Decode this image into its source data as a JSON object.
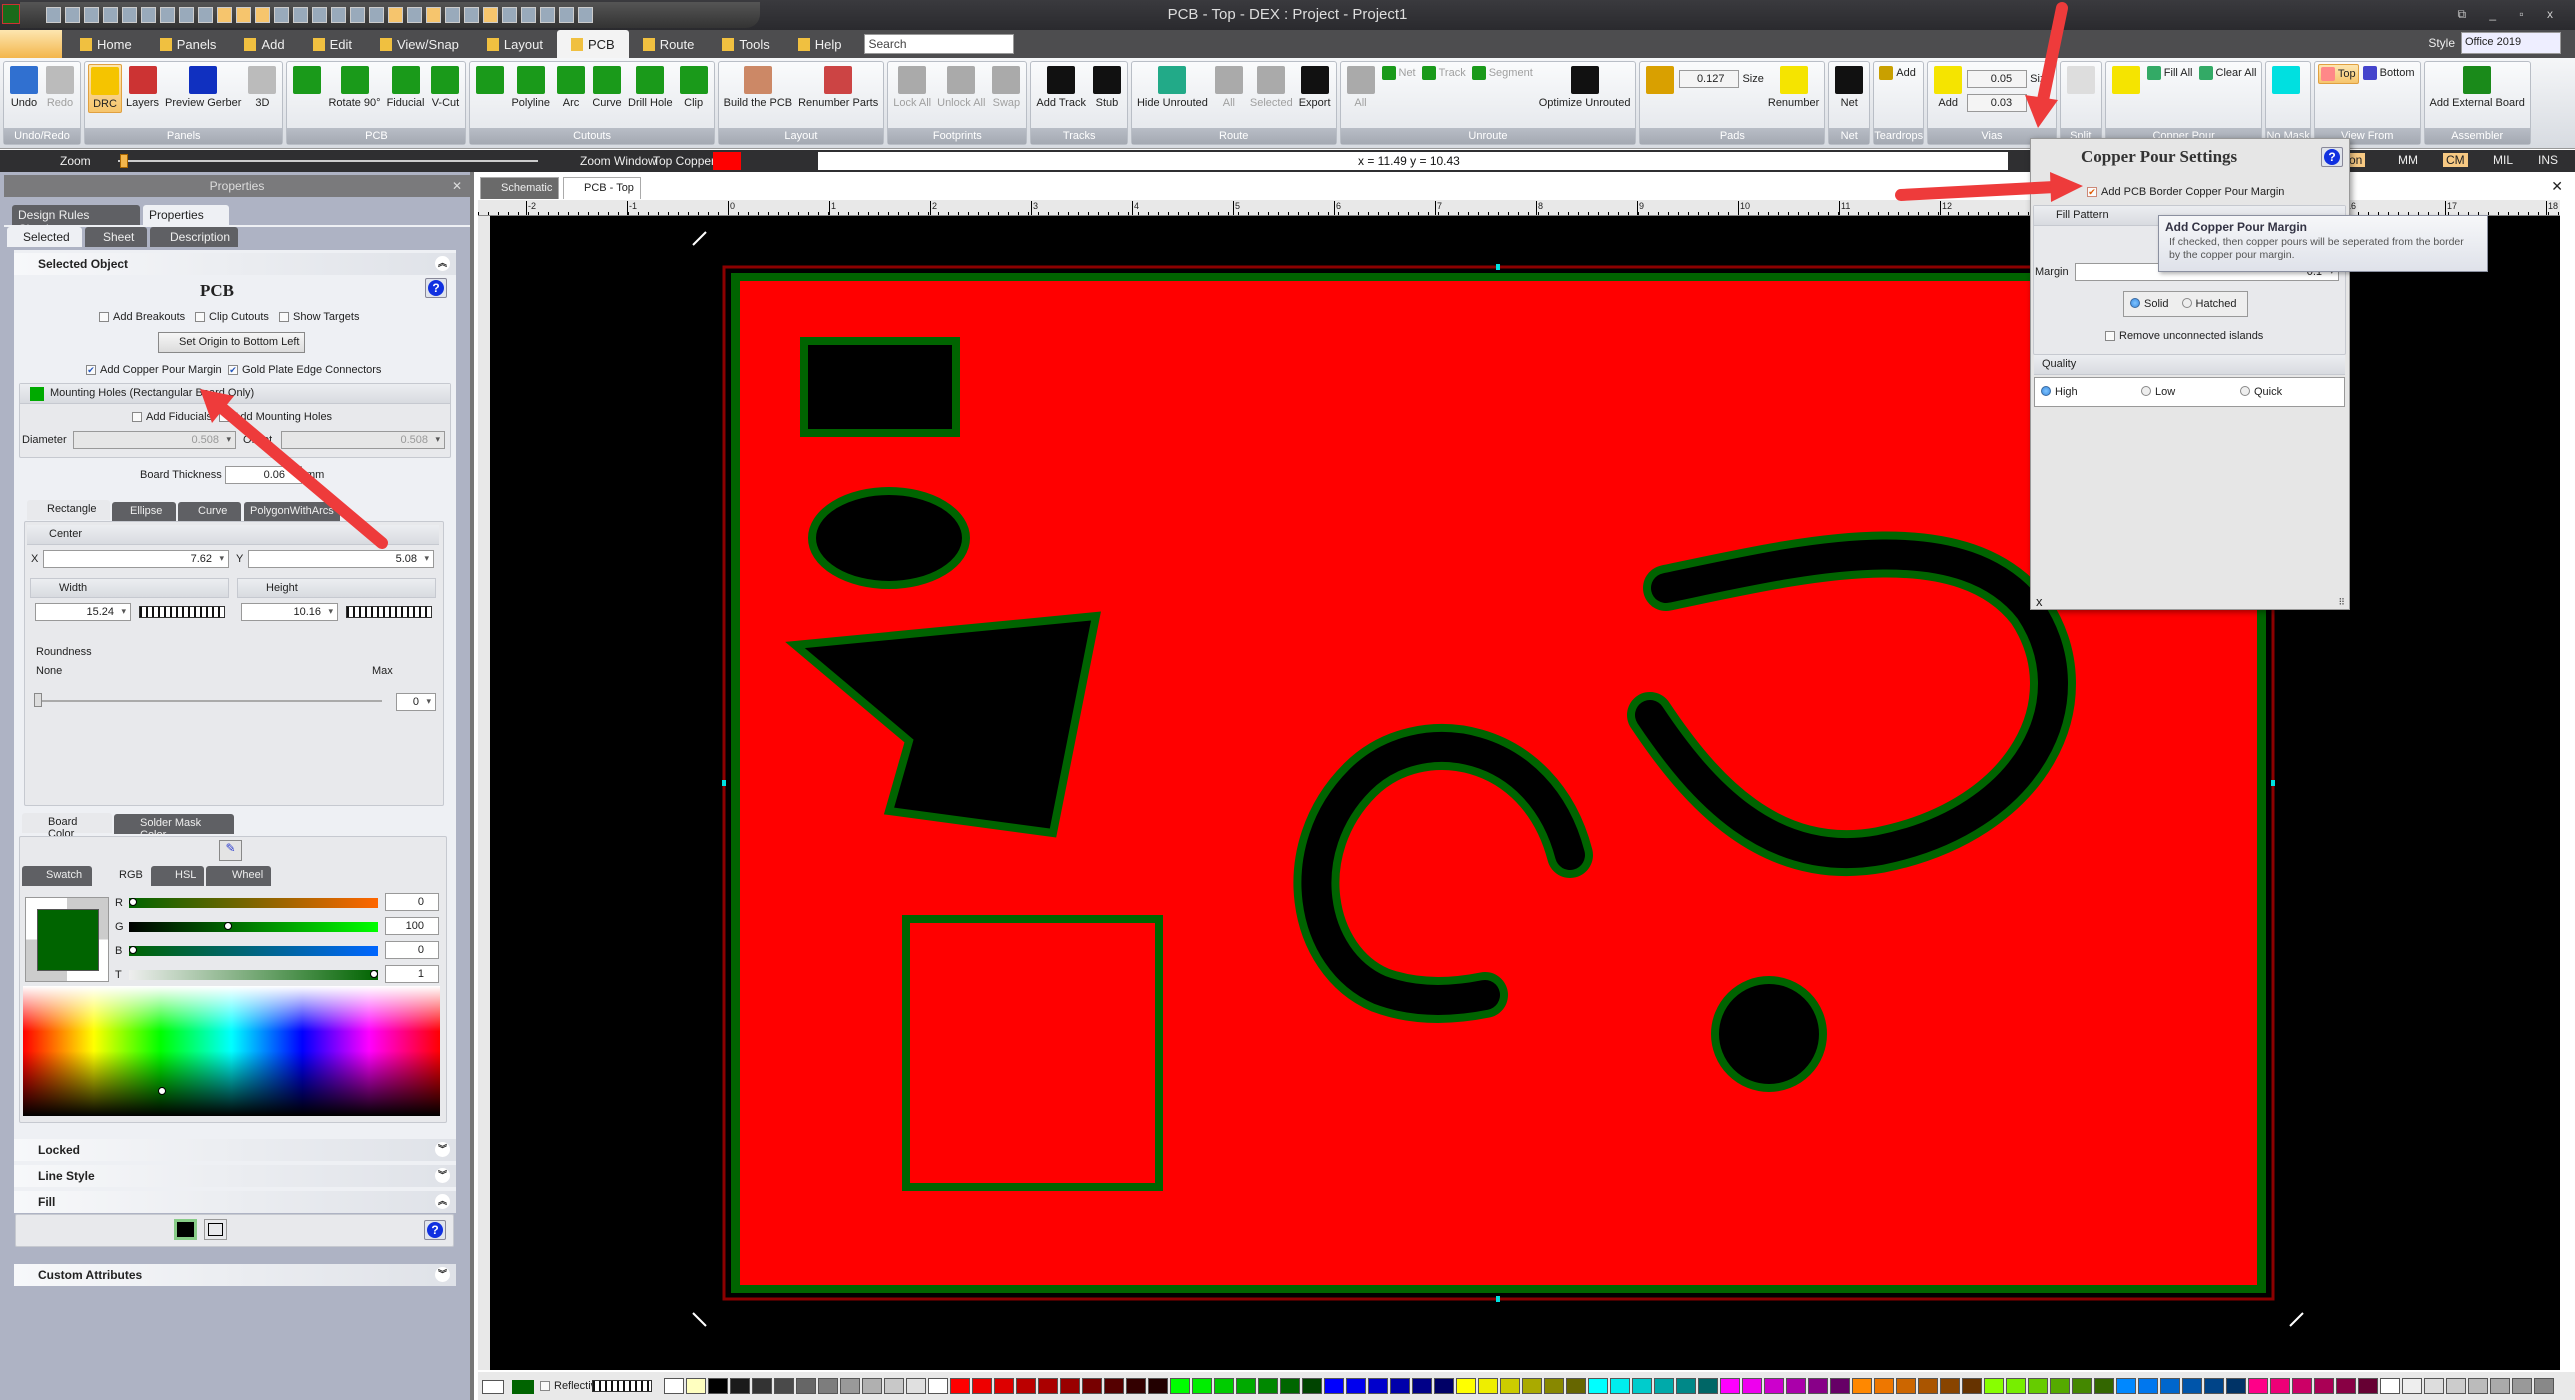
{
  "window": {
    "title": "PCB - Top - DEX : Project - Project1",
    "controls": "⧉ _ ▫ x"
  },
  "menu": {
    "tabs": [
      {
        "label": "Home"
      },
      {
        "label": "Panels"
      },
      {
        "label": "Add"
      },
      {
        "label": "Edit"
      },
      {
        "label": "View/Snap"
      },
      {
        "label": "Layout"
      },
      {
        "label": "PCB",
        "active": true
      },
      {
        "label": "Route"
      },
      {
        "label": "Tools"
      },
      {
        "label": "Help"
      }
    ],
    "search_placeholder": "Search",
    "style_label": "Style",
    "style_value": "Office 2019"
  },
  "ribbon": {
    "groups": [
      {
        "label": "Undo/Redo",
        "buttons": [
          {
            "label": "Undo",
            "icon": "undo-icon"
          },
          {
            "label": "Redo",
            "icon": "redo-icon",
            "disabled": true
          }
        ]
      },
      {
        "label": "Panels",
        "buttons": [
          {
            "label": "DRC",
            "icon": "warning-icon",
            "active": true
          },
          {
            "label": "Layers",
            "icon": "layers-icon"
          },
          {
            "label": "Preview Gerber",
            "icon": "gerber-icon"
          },
          {
            "label": "3D",
            "icon": "cube-icon"
          }
        ]
      },
      {
        "label": "PCB",
        "buttons": [
          {
            "label": "",
            "icon": "board-shapes-icon"
          },
          {
            "label": "Rotate 90°",
            "icon": "rotate-icon"
          },
          {
            "label": "Fiducial",
            "icon": "fiducial-icon"
          },
          {
            "label": "V-Cut",
            "icon": "vcut-icon"
          }
        ]
      },
      {
        "label": "Cutouts",
        "buttons": [
          {
            "label": "",
            "icon": "cutout-shapes-icon"
          },
          {
            "label": "Polyline",
            "icon": "polyline-icon"
          },
          {
            "label": "Arc",
            "icon": "arc-icon"
          },
          {
            "label": "Curve",
            "icon": "curve-icon"
          },
          {
            "label": "Drill Hole",
            "icon": "drill-icon"
          },
          {
            "label": "Clip",
            "icon": "clip-icon"
          }
        ]
      },
      {
        "label": "Layout",
        "buttons": [
          {
            "label": "Build the PCB",
            "icon": "build-icon"
          },
          {
            "label": "Renumber Parts",
            "icon": "renumber-parts-icon"
          }
        ]
      },
      {
        "label": "Footprints",
        "buttons": [
          {
            "label": "Lock All",
            "icon": "lock-icon",
            "disabled": true
          },
          {
            "label": "Unlock All",
            "icon": "unlock-icon",
            "disabled": true
          },
          {
            "label": "Swap",
            "icon": "swap-icon",
            "disabled": true
          }
        ]
      },
      {
        "label": "Tracks",
        "buttons": [
          {
            "label": "Add Track",
            "icon": "add-track-icon"
          },
          {
            "label": "Stub",
            "icon": "stub-icon"
          }
        ]
      },
      {
        "label": "Route",
        "buttons": [
          {
            "label": "Hide Unrouted",
            "icon": "hide-icon"
          },
          {
            "label": "All",
            "icon": "route-all-icon",
            "disabled": true
          },
          {
            "label": "Selected",
            "icon": "route-selected-icon",
            "disabled": true
          },
          {
            "label": "Export",
            "icon": "export-icon"
          }
        ]
      },
      {
        "label": "Unroute",
        "buttons": [
          {
            "label": "All",
            "icon": "unroute-all-icon",
            "disabled": true
          },
          {
            "label": "Net",
            "icon": "unroute-net-icon",
            "disabled": true,
            "small": true
          },
          {
            "label": "Track",
            "icon": "unroute-track-icon",
            "disabled": true,
            "small": true
          },
          {
            "label": "Segment",
            "icon": "unroute-segment-icon",
            "disabled": true,
            "small": true
          },
          {
            "label": "Optimize Unrouted",
            "icon": "optimize-icon"
          }
        ]
      },
      {
        "label": "Pads",
        "buttons": [
          {
            "label": "",
            "icon": "pad-shapes-icon"
          }
        ],
        "inputs": [
          {
            "label": "Size",
            "value": "0.127"
          }
        ],
        "buttons_after": [
          {
            "label": "Renumber",
            "icon": "renumber-icon"
          }
        ]
      },
      {
        "label": "Net",
        "buttons": [
          {
            "label": "Net",
            "icon": "net-icon"
          }
        ]
      },
      {
        "label": "Teardrops",
        "buttons": [
          {
            "label": "Add",
            "icon": "teardrop-icon",
            "small": true
          }
        ]
      },
      {
        "label": "Vias",
        "buttons": [
          {
            "label": "Add",
            "icon": "via-icon"
          }
        ],
        "inputs": [
          {
            "label": "Size",
            "value": "0.05"
          },
          {
            "label": "Hole",
            "value": "0.03"
          }
        ]
      },
      {
        "label": "Split",
        "buttons": [
          {
            "label": "",
            "icon": "split-icon"
          }
        ]
      },
      {
        "label": "Copper Pour",
        "buttons": [
          {
            "label": "",
            "icon": "pour-shapes-icon"
          },
          {
            "label": "Fill All",
            "icon": "fill-all-icon",
            "small": true
          },
          {
            "label": "Clear All",
            "icon": "clear-all-icon",
            "small": true
          }
        ]
      },
      {
        "label": "No Mask",
        "buttons": [
          {
            "label": "",
            "icon": "no-mask-icon"
          }
        ]
      },
      {
        "label": "View From",
        "buttons": [
          {
            "label": "Top",
            "icon": "view-top-icon",
            "small": true,
            "active": true
          },
          {
            "label": "Bottom",
            "icon": "view-bottom-icon",
            "small": true
          }
        ]
      },
      {
        "label": "Assembler",
        "buttons": [
          {
            "label": "Add External Board",
            "icon": "external-board-icon"
          }
        ]
      }
    ]
  },
  "zoombar": {
    "zoom_label": "Zoom",
    "zoom_window": "Zoom Window",
    "layer": "Top Copper",
    "layer_color": "#ff0000",
    "coordinates": "x = 11.49 y = 10.43",
    "selection_partial": "tion",
    "units": [
      {
        "label": "MM"
      },
      {
        "label": "CM",
        "active": true
      },
      {
        "label": "MIL"
      },
      {
        "label": "INS"
      }
    ]
  },
  "properties": {
    "panel_title": "Properties",
    "tabs": [
      "Design Rules Checker",
      "Properties"
    ],
    "subtabs": [
      "Selected",
      "Sheet",
      "Description"
    ],
    "section_title": "Selected Object",
    "object_title": "PCB",
    "add_breakouts": {
      "label": "Add Breakouts",
      "checked": false
    },
    "clip_cutouts": {
      "label": "Clip Cutouts",
      "checked": false
    },
    "show_targets": {
      "label": "Show Targets",
      "checked": false
    },
    "set_origin": "Set Origin to Bottom Left",
    "add_copper_pour_margin": {
      "label": "Add Copper Pour Margin",
      "checked": true
    },
    "gold_plate": {
      "label": "Gold Plate Edge Connectors",
      "checked": true
    },
    "mounting_holes": {
      "title": "Mounting Holes (Rectangular Board Only)",
      "add_fiducials": "Add Fiducials",
      "add_mounting_holes": "Add Mounting Holes",
      "diameter_label": "Diameter",
      "diameter": "0.508",
      "offset_label": "Offset",
      "offset": "0.508"
    },
    "board_thickness_label": "Board Thickness",
    "board_thickness": "0.06",
    "board_thickness_unit": "mm",
    "shape_tabs": [
      "Rectangle",
      "Ellipse",
      "Curve",
      "PolygonWithArcs"
    ],
    "center_label": "Center",
    "x_label": "X",
    "x": "7.62",
    "y_label": "Y",
    "y": "5.08",
    "width_label": "Width",
    "width": "15.24",
    "height_label": "Height",
    "height": "10.16",
    "roundness_label": "Roundness",
    "roundness_min": "None",
    "roundness_max": "Max",
    "roundness": "0",
    "color_tabs": [
      "Board Color",
      "Solder Mask Color"
    ],
    "color_mode_tabs": [
      "Swatch",
      "RGB",
      "HSL",
      "Wheel"
    ],
    "rgb": [
      {
        "label": "R",
        "value": "0"
      },
      {
        "label": "G",
        "value": "100"
      },
      {
        "label": "B",
        "value": "0"
      },
      {
        "label": "T",
        "value": "1"
      }
    ],
    "board_color": "#006400",
    "sections": [
      "Locked",
      "Line Style",
      "Fill",
      "Custom Attributes"
    ]
  },
  "documents": {
    "tabs": [
      "Schematic",
      "PCB - Top"
    ],
    "active": 1,
    "ruler_labels": [
      "-2",
      "-1",
      "0",
      "1",
      "2",
      "3",
      "4",
      "5",
      "6",
      "7",
      "8",
      "9",
      "10",
      "11",
      "12",
      "13",
      "14",
      "15",
      "16",
      "17",
      "18"
    ]
  },
  "bottombar": {
    "reflective": "Reflective"
  },
  "copper_pour": {
    "title": "Copper Pour Settings",
    "add_border_margin": {
      "label": "Add  PCB Border Copper Pour Margin",
      "checked": true
    },
    "fill_pattern": "Fill Pattern",
    "margin_label": "Margin",
    "margin": "0.1",
    "pattern_options": [
      {
        "label": "Solid",
        "selected": true
      },
      {
        "label": "Hatched"
      }
    ],
    "remove_islands": {
      "label": "Remove unconnected islands",
      "checked": false
    },
    "quality_label": "Quality",
    "quality_options": [
      {
        "label": "High",
        "selected": true
      },
      {
        "label": "Low"
      },
      {
        "label": "Quick"
      }
    ],
    "close": "x"
  },
  "tooltip": {
    "title": "Add Copper Pour Margin",
    "body": "If checked, then copper pours will be seperated from the border by the copper pour margin."
  },
  "colors": {
    "board_fill": "#ff0000",
    "copper_margin": "#006400",
    "canvas": "#000000",
    "arrow": "#ee3b3b"
  }
}
